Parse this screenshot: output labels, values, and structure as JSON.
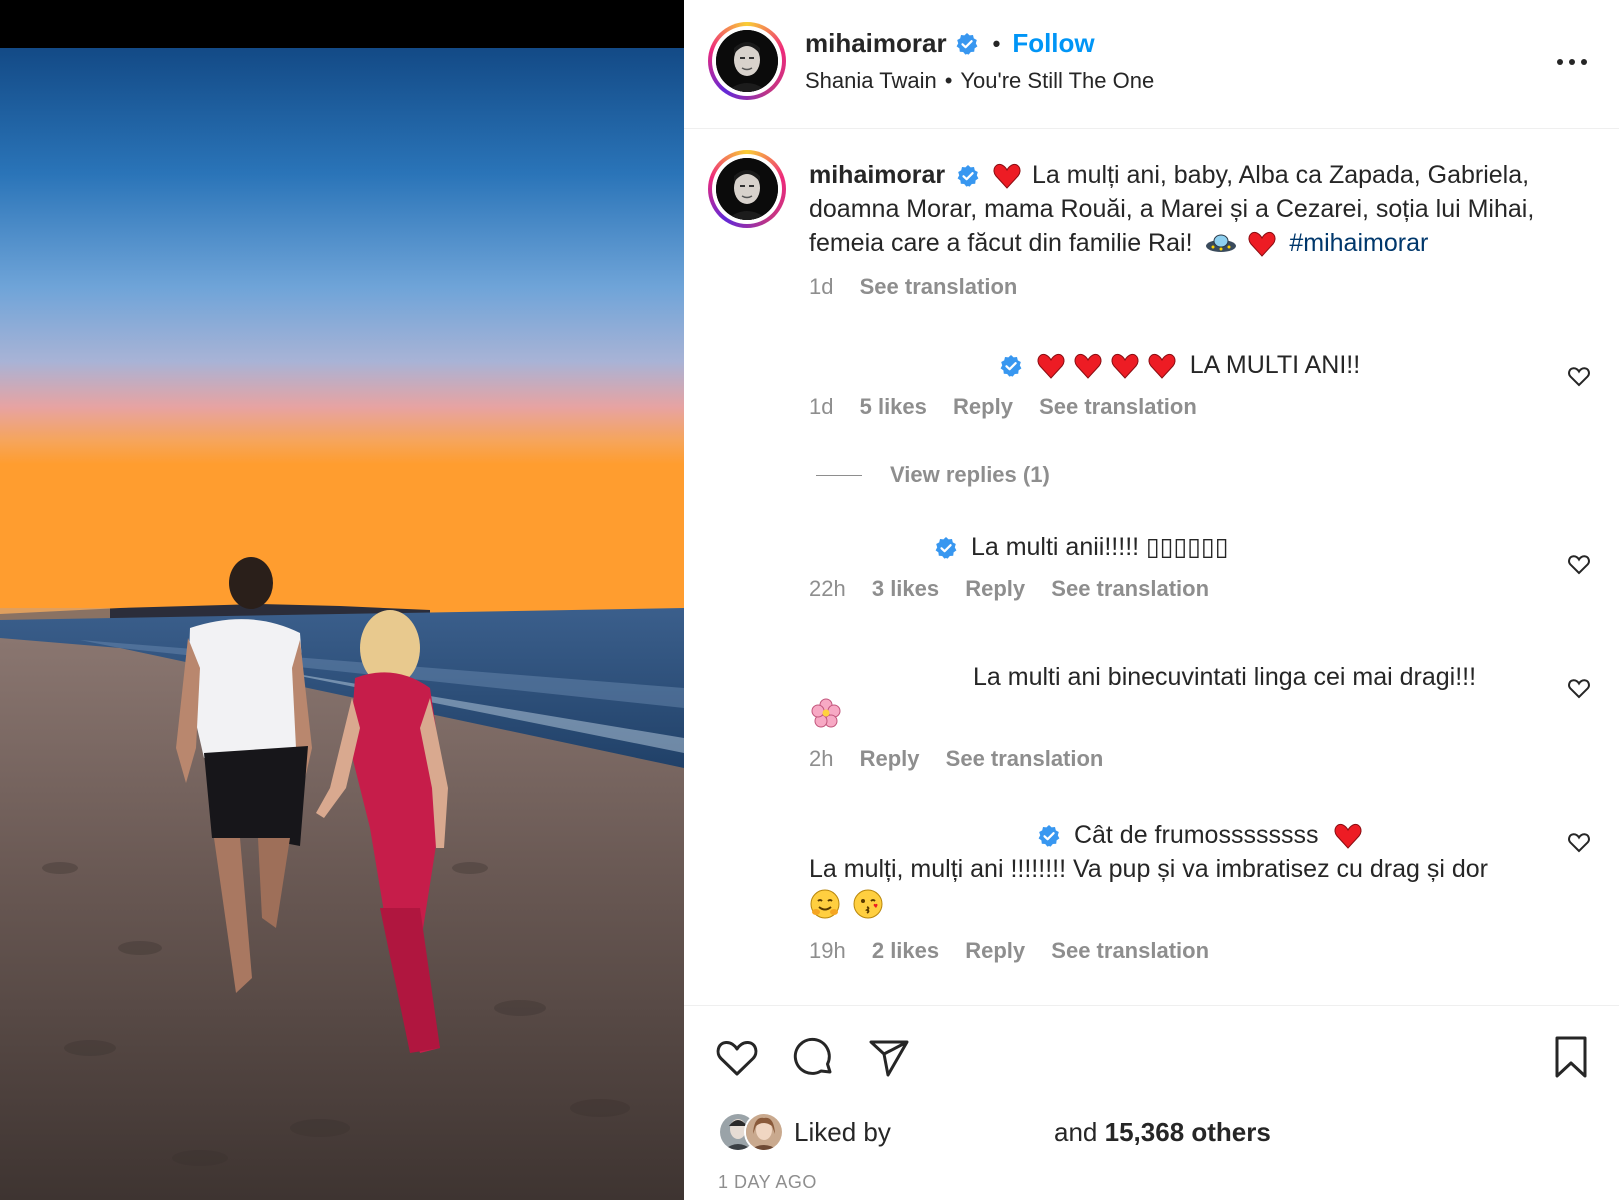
{
  "header": {
    "username": "mihaimorar",
    "follow_label": "Follow",
    "dot": "•",
    "music_artist": "Shania Twain",
    "music_separator": "•",
    "music_track": "You're Still The One",
    "more_icon": "more-horizontal-icon"
  },
  "caption": {
    "username": "mihaimorar",
    "text": "La mulți ani, baby, Alba ca Zapada, Gabriela, doamna Morar, mama Rouăi, a Marei și a Cezarei, soția lui Mihai, femeia care a făcut din familie Rai!",
    "hashtag": "#mihaimorar",
    "time": "1d",
    "see_translation": "See translation"
  },
  "comments": [
    {
      "text": "LA MULTI ANI!!",
      "time": "1d",
      "likes": "5 likes",
      "reply": "Reply",
      "see_translation": "See translation",
      "view_replies": "View replies (1)"
    },
    {
      "text": "La multi anii!!!!! ▯▯▯▯▯▯",
      "time": "22h",
      "likes": "3 likes",
      "reply": "Reply",
      "see_translation": "See translation"
    },
    {
      "text": "La multi ani binecuvintati linga cei mai dragi!!!",
      "time": "2h",
      "reply": "Reply",
      "see_translation": "See translation"
    },
    {
      "text_line1": "Cât de frumossssssss",
      "text_line2": "La mulți, mulți ani !!!!!!!! Va pup și va imbratisez cu drag și dor",
      "time": "19h",
      "likes": "2 likes",
      "reply": "Reply",
      "see_translation": "See translation"
    }
  ],
  "actions": {
    "icons": [
      "heart-icon",
      "comment-icon",
      "share-icon",
      "bookmark-icon"
    ]
  },
  "likes": {
    "liked_by": "Liked by",
    "and": "and",
    "count": "15,368 others"
  },
  "posted": "1 DAY AGO",
  "colors": {
    "link_blue": "#0095f6",
    "hashtag": "#00376b",
    "secondary_text": "#8e8e8e",
    "heart_red": "#ed1c24",
    "verified": "#3897f0"
  }
}
